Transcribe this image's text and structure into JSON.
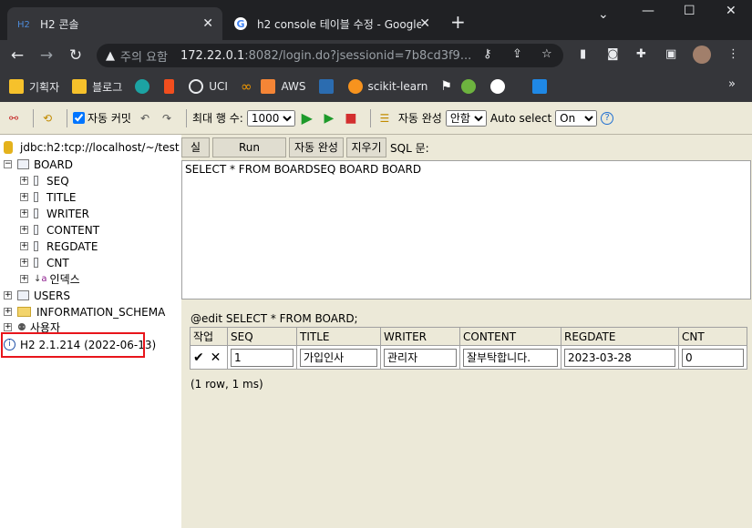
{
  "browser": {
    "tabs": [
      {
        "title": "H2 콘솔",
        "active": true,
        "icon": "h2-favicon"
      },
      {
        "title": "h2 console 테이블 수정 - Google",
        "active": false,
        "icon": "google-favicon"
      }
    ],
    "address": {
      "security_label": "주의 요함",
      "host": "172.22.0.1",
      "rest": ":8082/login.do?jsessionid=7b8cd3f9..."
    },
    "bookmarks": [
      {
        "label": "기획자",
        "icon": "folder-icon",
        "color": "#f6c12b"
      },
      {
        "label": "블로그",
        "icon": "folder-icon",
        "color": "#f6c12b"
      },
      {
        "label": "",
        "icon": "edge-icon",
        "color": "#1ca3a3"
      },
      {
        "label": "",
        "icon": "figma-icon",
        "color": "#f24e1e"
      },
      {
        "label": "UCI",
        "icon": "globe-icon",
        "color": "#e8eaed"
      },
      {
        "label": "",
        "icon": "infinity-icon",
        "color": "#f29900"
      },
      {
        "label": "AWS",
        "icon": "cube-icon",
        "color": "#f58536"
      },
      {
        "label": "",
        "icon": "msa-icon",
        "color": "#2b6cb0"
      },
      {
        "label": "scikit-learn",
        "icon": "scikit-icon",
        "color": "#f7931e"
      },
      {
        "label": "",
        "icon": "flag-icon",
        "color": "#ffffff"
      },
      {
        "label": "",
        "icon": "leaf-icon",
        "color": "#6db33f"
      },
      {
        "label": "",
        "icon": "github-icon",
        "color": "#ffffff"
      },
      {
        "label": "",
        "icon": "x-app-icon",
        "color": "#1f88e5"
      }
    ]
  },
  "h2_toolbar": {
    "autocommit_label": "자동 커밋",
    "autocommit_checked": true,
    "maxrows_label": "최대 행 수:",
    "maxrows_value": "1000",
    "autocomplete_label": "자동 완성",
    "autocomplete_value": "안함",
    "autoselect_label": "Auto select",
    "autoselect_value": "On",
    "help_label": "?"
  },
  "tree": {
    "connection": "jdbc:h2:tcp://localhost/~/test",
    "table": "BOARD",
    "columns": [
      "SEQ",
      "TITLE",
      "WRITER",
      "CONTENT",
      "REGDATE",
      "CNT"
    ],
    "indexes": "인덱스",
    "other_nodes": [
      "USERS",
      "INFORMATION_SCHEMA",
      "사용자"
    ],
    "version": "H2 2.1.214 (2022-06-13)"
  },
  "editor": {
    "buttons": [
      "실행",
      "Run Selected",
      "자동 완성",
      "지우기"
    ],
    "sql_label": "SQL 문:",
    "sql_text": "SELECT * FROM BOARDSEQ BOARD BOARD"
  },
  "result": {
    "header": "@edit SELECT * FROM BOARD;",
    "columns": [
      "작업",
      "SEQ",
      "TITLE",
      "WRITER",
      "CONTENT",
      "REGDATE",
      "CNT"
    ],
    "row": [
      "1",
      "가입인사",
      "관리자",
      "잘부탁합니다.",
      "2023-03-28",
      "0"
    ],
    "row_count": "(1 row, 1 ms)"
  }
}
